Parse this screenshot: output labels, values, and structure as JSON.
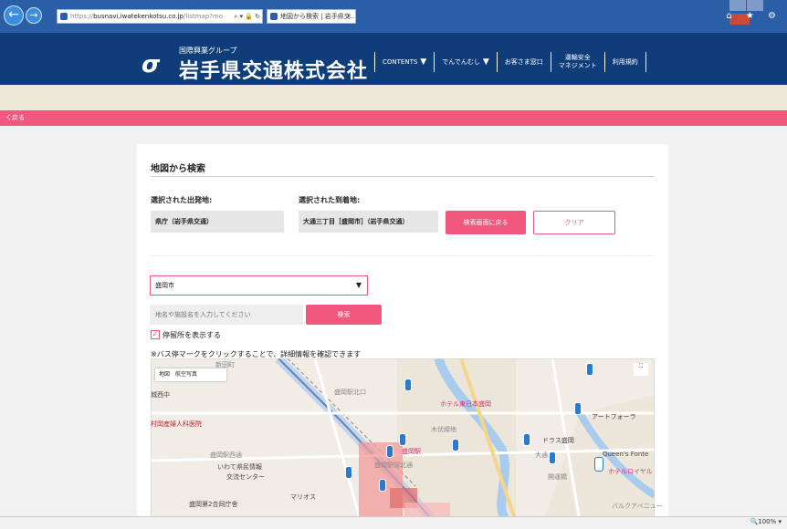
{
  "browser": {
    "url_prefix": "https://",
    "url_host": "busnavi.iwatekenkotsu.co.jp",
    "url_path": "/listmap?mo",
    "addr_controls": "⌕ ▾ 🔒 ↻",
    "tab_title": "地図から検索 | 岩手県交...",
    "tab_close": "×",
    "right_icons": "⌂ ★ ⚙"
  },
  "header": {
    "logo_mark": "σ",
    "group_name": "国際興業グループ",
    "company_name": "岩手県交通株式会社",
    "nav": [
      {
        "label": "CONTENTS",
        "caret": "▼"
      },
      {
        "label": "でんでんむし",
        "caret": "▼"
      },
      {
        "label": "お客さま窓口",
        "caret": ""
      },
      {
        "label": "運輸安全\nマネジメント",
        "caret": ""
      },
      {
        "label": "利用規約",
        "caret": ""
      }
    ]
  },
  "pinkbar": {
    "back_label": "く戻る"
  },
  "page": {
    "title": "地図から検索",
    "departure_label": "選択された出発地:",
    "departure_value": "県庁（岩手県交通）",
    "arrival_label": "選択された到着地:",
    "arrival_value": "大通三丁目［盛岡市］（岩手県交通）",
    "search_again_button": "検索画面に戻る",
    "clear_button": "クリア",
    "city_select": "盛岡市",
    "select_arrow": "▼",
    "keyword_placeholder": "地名や施設名を入力してください",
    "search_button": "検索",
    "show_stops_checked": "✓",
    "show_stops_label": "停留所を表示する",
    "note": "※バス停マークをクリックすることで、詳細情報を確認できます"
  },
  "map": {
    "type_map": "地図",
    "type_satellite": "航空写真",
    "zoom_icon": "⛶",
    "labels": [
      {
        "text": "新田町",
        "cls": "gray"
      },
      {
        "text": "城西中",
        "cls": ""
      },
      {
        "text": "村岡産婦人科医院",
        "cls": "red"
      },
      {
        "text": "盛岡駅北口",
        "cls": "gray"
      },
      {
        "text": "ホテル東日本盛岡",
        "cls": "pink"
      },
      {
        "text": "木伏緑地",
        "cls": "gray"
      },
      {
        "text": "アートフォーラ",
        "cls": ""
      },
      {
        "text": "盛岡駅西通",
        "cls": "gray"
      },
      {
        "text": "いわて県民情報",
        "cls": ""
      },
      {
        "text": "交流センター",
        "cls": ""
      },
      {
        "text": "盛岡駅前北通",
        "cls": "gray"
      },
      {
        "text": "盛岡駅",
        "cls": "pink"
      },
      {
        "text": "マリオス",
        "cls": ""
      },
      {
        "text": "盛岡第2合同庁舎",
        "cls": ""
      },
      {
        "text": "Queen's Fonte",
        "cls": ""
      },
      {
        "text": "ホテルロイヤル",
        "cls": "pink"
      },
      {
        "text": "バルクアベニュー",
        "cls": "gray"
      },
      {
        "text": "開運橋",
        "cls": "gray"
      },
      {
        "text": "大通",
        "cls": "gray"
      },
      {
        "text": "ドラス盛岡",
        "cls": ""
      }
    ]
  },
  "status": {
    "zoom": "🔍100% ▾"
  }
}
